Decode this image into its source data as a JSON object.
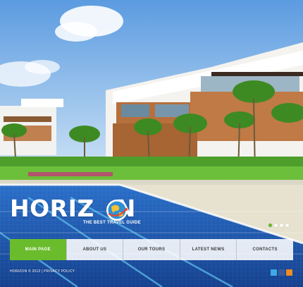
{
  "brand": {
    "name_part1": "HORIZ",
    "name_part2": "N",
    "tagline": "THE BEST TRAVEL GUIDE"
  },
  "slider": {
    "slide_count": 4,
    "active_index": 0
  },
  "nav": {
    "items": [
      {
        "label": "MAIN PAGE",
        "active": true
      },
      {
        "label": "ABOUT US",
        "active": false
      },
      {
        "label": "OUR TOURS",
        "active": false
      },
      {
        "label": "LATEST NEWS",
        "active": false
      },
      {
        "label": "CONTACTS",
        "active": false
      }
    ]
  },
  "footer": {
    "copyright": "HORIZON © 2012",
    "separator": "|",
    "privacy_link": "PRIVACY POLICY"
  },
  "social": [
    {
      "icon": "twitter-icon",
      "color": "#3fa9e6"
    },
    {
      "icon": "facebook-icon",
      "color": "#3a5a98"
    },
    {
      "icon": "rss-icon",
      "color": "#f08a24"
    }
  ],
  "colors": {
    "accent": "#6bbc2d",
    "pool": "#1f56b3",
    "sky": "#7fb6e8"
  }
}
